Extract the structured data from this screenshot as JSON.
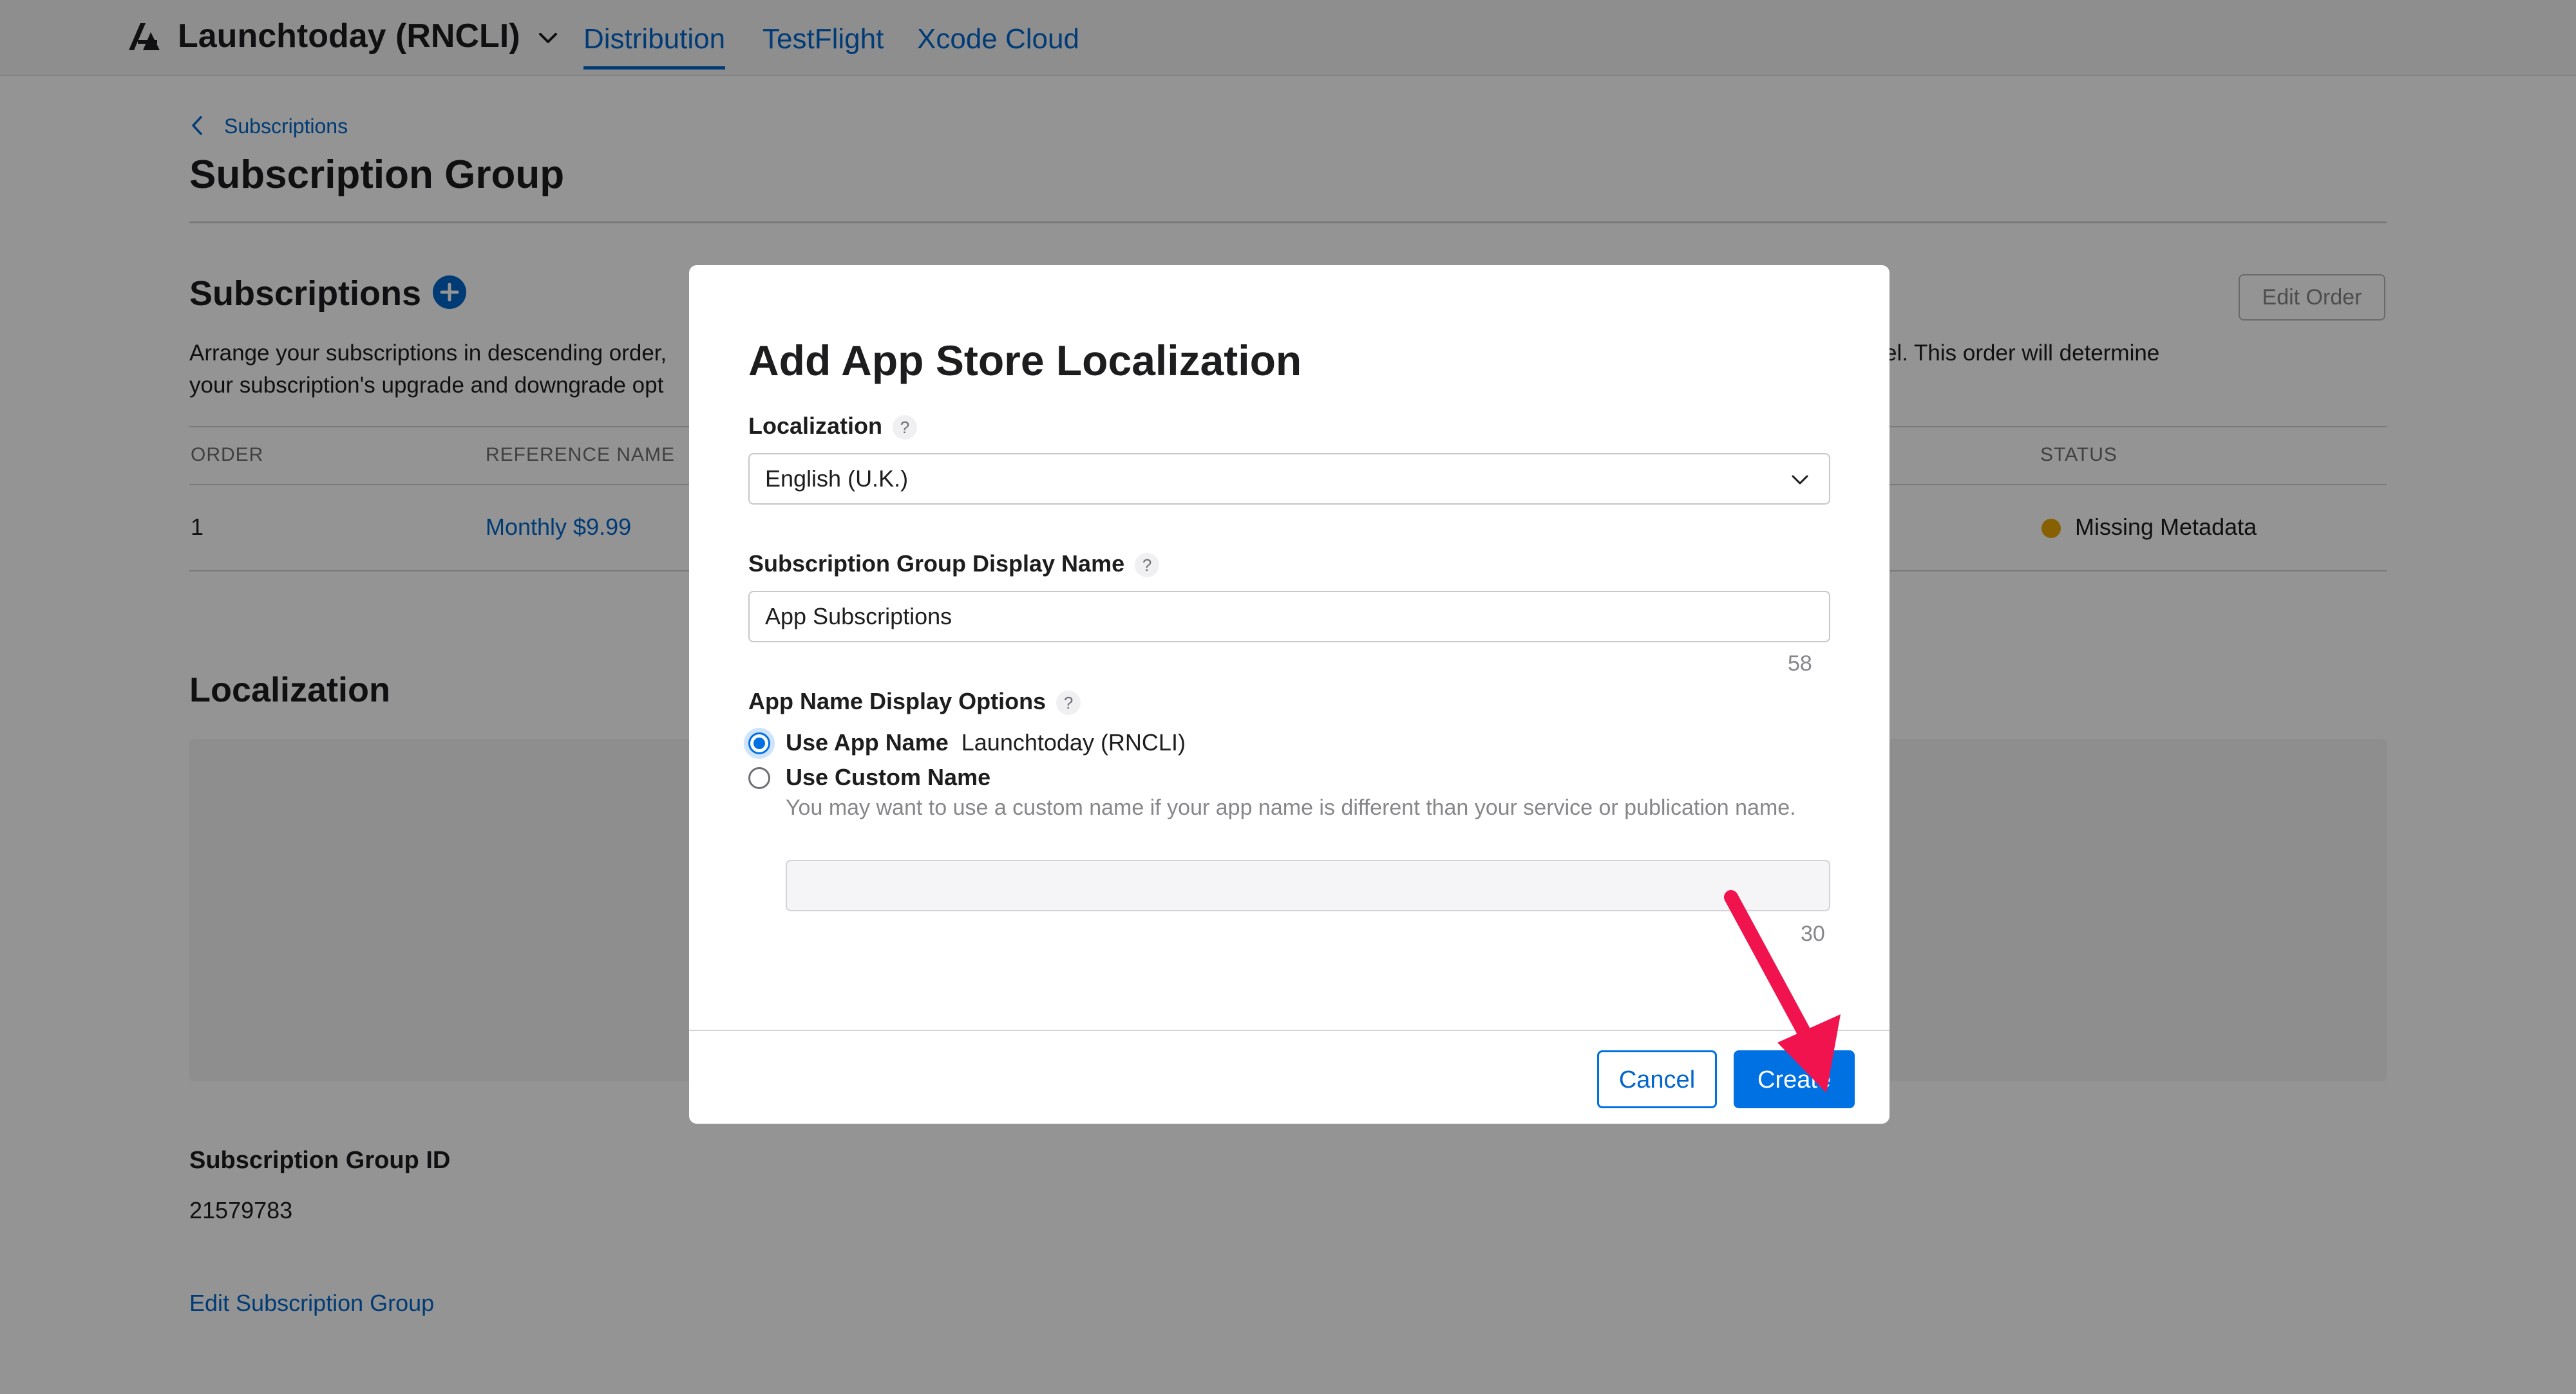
{
  "header": {
    "app_name": "Launchtoday (RNCLI)",
    "tabs": [
      {
        "label": "Distribution",
        "active": true
      },
      {
        "label": "TestFlight",
        "active": false
      },
      {
        "label": "Xcode Cloud",
        "active": false
      }
    ]
  },
  "breadcrumb": {
    "label": "Subscriptions"
  },
  "page": {
    "title": "Subscription Group"
  },
  "subscriptions": {
    "title": "Subscriptions",
    "edit_order_label": "Edit Order",
    "description": "Arrange your subscriptions in descending order, […] el. This order will determine your subscription's upgrade and downgrade opt[…]",
    "description_line1_left": "Arrange your subscriptions in descending order,",
    "description_line1_right": "el. This order will determine",
    "description_line2_left": "your subscription's upgrade and downgrade opt",
    "columns": [
      "ORDER",
      "REFERENCE NAME",
      "STATUS"
    ],
    "rows": [
      {
        "order": "1",
        "reference_name": "Monthly $9.99",
        "status": "Missing Metadata"
      }
    ]
  },
  "localization_section": {
    "title": "Localization"
  },
  "group_id": {
    "label": "Subscription Group ID",
    "value": "21579783"
  },
  "edit_group_link": "Edit Subscription Group",
  "modal": {
    "title": "Add App Store Localization",
    "localization_label": "Localization",
    "localization_value": "English (U.K.)",
    "display_name_label": "Subscription Group Display Name",
    "display_name_value": "App Subscriptions",
    "display_name_counter": "58",
    "app_name_options_label": "App Name Display Options",
    "option_app_name_label": "Use App Name",
    "option_app_name_value": "Launchtoday (RNCLI)",
    "option_custom_label": "Use Custom Name",
    "option_custom_hint": "You may want to use a custom name if your app name is different than your service or publication name.",
    "custom_name_value": "",
    "custom_name_counter": "30",
    "help_glyph": "?",
    "cancel_label": "Cancel",
    "create_label": "Create",
    "selected_option": "use-app-name"
  },
  "colors": {
    "accent": "#0071e3",
    "link": "#0066cc",
    "status_warning": "#e8a500",
    "annotation_arrow": "#f0134d"
  }
}
